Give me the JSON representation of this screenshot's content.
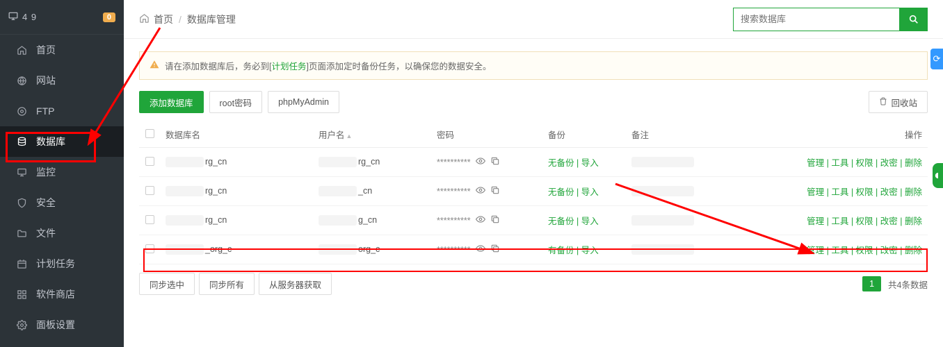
{
  "sidebar": {
    "server_ip": "4           9",
    "badge": "0",
    "items": [
      {
        "icon": "home",
        "label": "首页"
      },
      {
        "icon": "globe",
        "label": "网站"
      },
      {
        "icon": "ftp",
        "label": "FTP"
      },
      {
        "icon": "db",
        "label": "数据库",
        "active": true
      },
      {
        "icon": "monitor",
        "label": "监控"
      },
      {
        "icon": "shield",
        "label": "安全"
      },
      {
        "icon": "folder",
        "label": "文件"
      },
      {
        "icon": "calendar",
        "label": "计划任务"
      },
      {
        "icon": "grid",
        "label": "软件商店"
      },
      {
        "icon": "gear",
        "label": "面板设置"
      }
    ]
  },
  "breadcrumb": {
    "home": "首页",
    "current": "数据库管理"
  },
  "search": {
    "placeholder": "搜索数据库"
  },
  "alert": {
    "pre": "请在添加数据库后，务必到[",
    "link": "计划任务",
    "post": "]页面添加定时备份任务，以确保您的数据安全。"
  },
  "actions": {
    "add": "添加数据库",
    "root": "root密码",
    "pma": "phpMyAdmin",
    "recycle": "回收站"
  },
  "columns": {
    "name": "数据库名",
    "user": "用户名",
    "pass": "密码",
    "backup": "备份",
    "remark": "备注",
    "op": "操作"
  },
  "rows": [
    {
      "name_suffix": "rg_cn",
      "user_suffix": "rg_cn",
      "pass": "**********",
      "backup": "无备份",
      "import": "导入"
    },
    {
      "name_suffix": "rg_cn",
      "user_suffix": "_cn",
      "pass": "**********",
      "backup": "无备份",
      "import": "导入"
    },
    {
      "name_suffix": "rg_cn",
      "user_suffix": "g_cn",
      "pass": "**********",
      "backup": "无备份",
      "import": "导入"
    },
    {
      "name_suffix": "_org_c",
      "user_suffix": "org_c",
      "pass": "**********",
      "backup": "有备份",
      "import": "导入"
    }
  ],
  "ops": {
    "manage": "管理",
    "tools": "工具",
    "perm": "权限",
    "chpass": "改密",
    "del": "删除",
    "sep": " | "
  },
  "bottom": {
    "sync_selected": "同步选中",
    "sync_all": "同步所有",
    "fetch": "从服务器获取",
    "page": "1",
    "total": "共4条数据"
  }
}
